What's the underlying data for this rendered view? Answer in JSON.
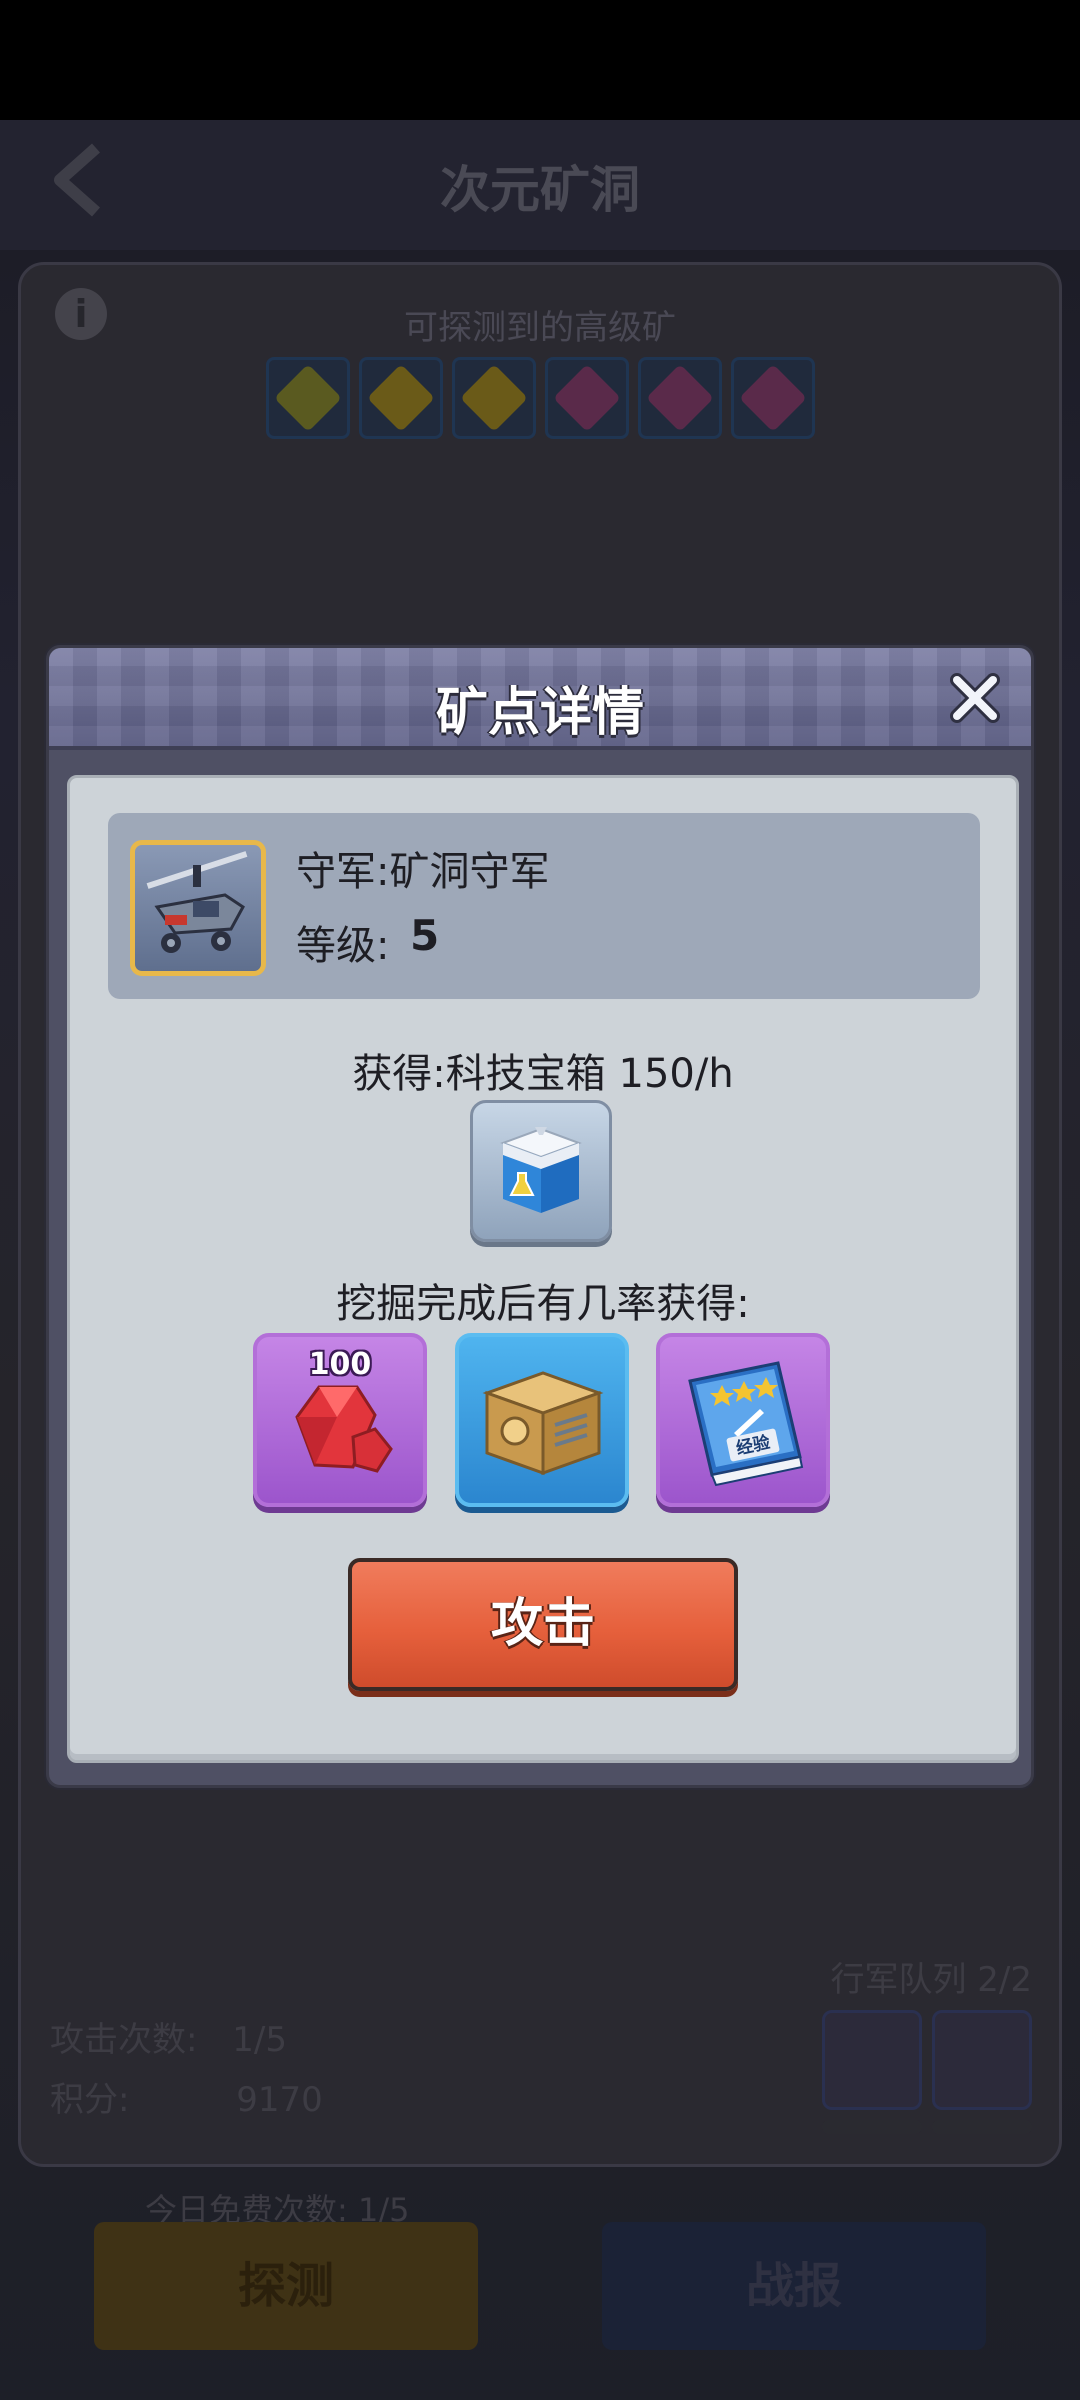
{
  "background": {
    "page_title": "次元矿洞",
    "ore_caption": "可探测到的高级矿",
    "stats": {
      "attack_count_label": "攻击次数:",
      "attack_count_value": "1/5",
      "score_label": "积分:",
      "score_value": "9170"
    },
    "march_queue_label": "行军队列 2/2",
    "free_count_label": "今日免费次数: 1/5",
    "detect_button": "探测",
    "report_button": "战报"
  },
  "modal": {
    "title": "矿点详情",
    "guard_name": "守军:矿洞守军",
    "level_label": "等级:",
    "level_value": "5",
    "obtain_text": "获得:科技宝箱 150/h",
    "chance_text": "挖掘完成后有几率获得:",
    "rewards": [
      {
        "name": "gem",
        "quantity": "100"
      },
      {
        "name": "crate",
        "quantity": ""
      },
      {
        "name": "exp-book",
        "label": "经验"
      }
    ],
    "attack_button": "攻击"
  },
  "colors": {
    "attack_button": "#e6603c",
    "modal_body": "#cdd3d8",
    "header": "#6e7096"
  }
}
